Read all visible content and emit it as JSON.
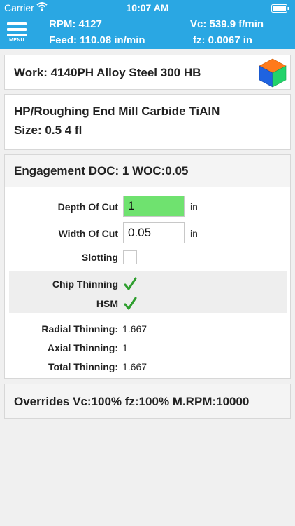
{
  "status_bar": {
    "carrier": "Carrier",
    "time": "10:07 AM"
  },
  "header": {
    "menu_label": "MENU",
    "rpm": "RPM: 4127",
    "vc": "Vc: 539.9 f/min",
    "feed": "Feed: 110.08 in/min",
    "fz": "fz: 0.0067 in"
  },
  "work_card": {
    "title": "Work: 4140PH Alloy Steel 300 HB",
    "icon": "material-cube-icon"
  },
  "tool_card": {
    "line1": "HP/Roughing End Mill Carbide TiAlN",
    "line2": "Size: 0.5 4 fl"
  },
  "engagement": {
    "title": "Engagement DOC: 1 WOC:0.05",
    "depth_of_cut": {
      "label": "Depth Of Cut",
      "value": "1",
      "unit": "in"
    },
    "width_of_cut": {
      "label": "Width Of Cut",
      "value": "0.05",
      "unit": "in"
    },
    "slotting": {
      "label": "Slotting",
      "checked": false
    },
    "chip_thinning": {
      "label": "Chip Thinning",
      "checked": true
    },
    "hsm": {
      "label": "HSM",
      "checked": true
    },
    "radial_thinning": {
      "label": "Radial Thinning:",
      "value": "1.667"
    },
    "axial_thinning": {
      "label": "Axial Thinning:",
      "value": "1"
    },
    "total_thinning": {
      "label": "Total Thinning:",
      "value": "1.667"
    }
  },
  "overrides": {
    "title": "Overrides Vc:100% fz:100% M.RPM:10000"
  },
  "colors": {
    "header": "#2aa7e3",
    "active_field": "#6fe26f",
    "check": "#2e9e2e"
  }
}
